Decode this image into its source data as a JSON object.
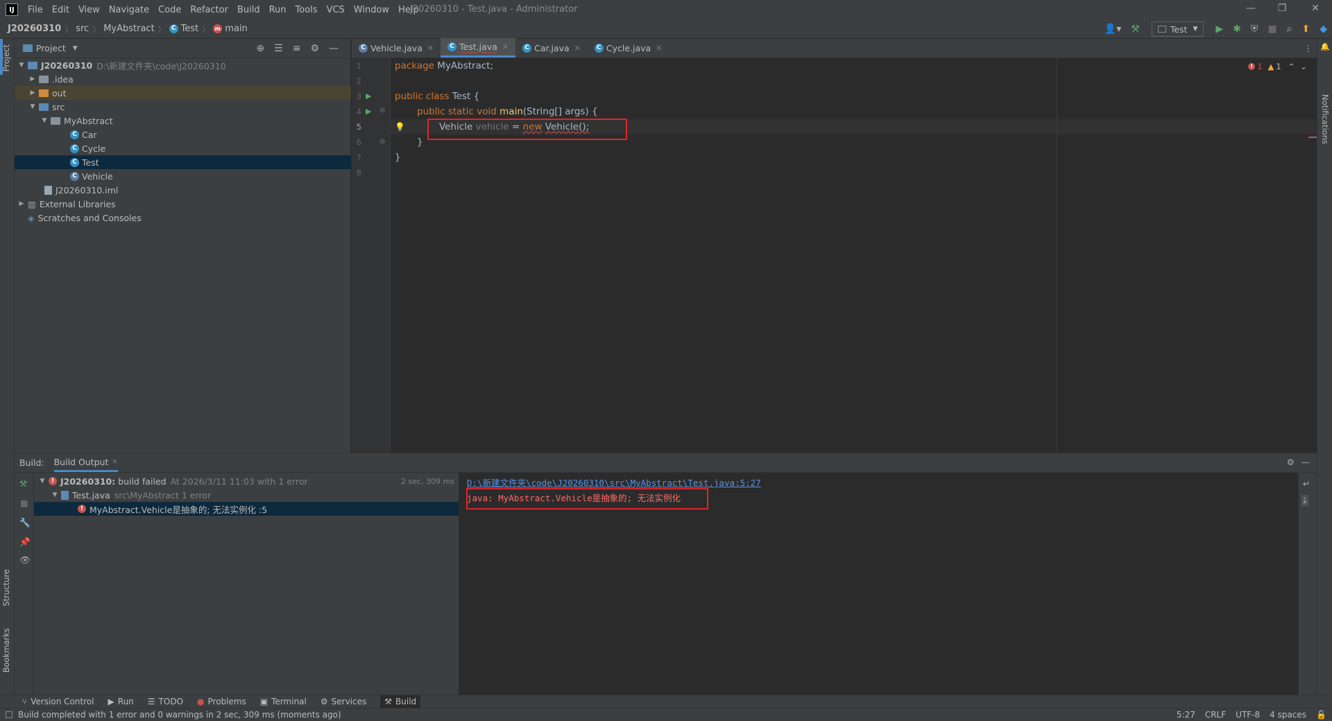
{
  "window": {
    "app_logo": "IJ",
    "title": "J20260310 - Test.java - Administrator"
  },
  "menu": [
    "File",
    "Edit",
    "View",
    "Navigate",
    "Code",
    "Refactor",
    "Build",
    "Run",
    "Tools",
    "VCS",
    "Window",
    "Help"
  ],
  "breadcrumbs": {
    "project": "J20260310",
    "src": "src",
    "package": "MyAbstract",
    "class": "Test",
    "method": "main"
  },
  "toolbar": {
    "run_config": "Test"
  },
  "left_strip": {
    "project_tab": "Project",
    "structure_tab": "Structure",
    "bookmarks_tab": "Bookmarks"
  },
  "right_strip": {
    "notifications_tab": "Notifications"
  },
  "project_panel": {
    "title": "Project",
    "tree": {
      "root": "J20260310",
      "root_path": "D:\\新建文件夹\\code\\J20260310",
      "idea": ".idea",
      "out": "out",
      "src": "src",
      "package": "MyAbstract",
      "car": "Car",
      "cycle": "Cycle",
      "test": "Test",
      "vehicle": "Vehicle",
      "iml": "J20260310.iml",
      "external": "External Libraries",
      "scratches": "Scratches and Consoles"
    }
  },
  "editor": {
    "tabs": [
      "Vehicle.java",
      "Test.java",
      "Car.java",
      "Cycle.java"
    ],
    "active_tab": "Test.java",
    "error_count": "1",
    "warning_count": "1",
    "line_numbers": [
      "1",
      "2",
      "3",
      "4",
      "5",
      "6",
      "7",
      "8"
    ],
    "code": {
      "l1_kw": "package",
      "l1_rest": " MyAbstract;",
      "l3_kw": "public class",
      "l3_rest": " Test {",
      "l4_kw": "public static void",
      "l4_fn": "main",
      "l4_rest": "(String[] args) {",
      "l5_type": "Vehicle",
      "l5_var": "vehicle",
      "l5_eq": " = ",
      "l5_new": "new",
      "l5_ctor": "Vehicle",
      "l5_end": "();",
      "l6": "}",
      "l7": "}"
    }
  },
  "build": {
    "label": "Build:",
    "tab": "Build Output",
    "summary_project": "J20260310:",
    "summary_text": "build failed",
    "summary_time": "At 2026/3/11 11:03 with 1 error",
    "summary_duration": "2 sec, 309 ms",
    "file": "Test.java",
    "file_path": "src\\MyAbstract 1 error",
    "error_item": "MyAbstract.Vehicle是抽象的; 无法实例化 :5",
    "output_link": "D:\\新建文件夹\\code\\J20260310\\src\\MyAbstract\\Test.java:5:27",
    "output_error": "java: MyAbstract.Vehicle是抽象的; 无法实例化"
  },
  "bottom_tools": [
    "Version Control",
    "Run",
    "TODO",
    "Problems",
    "Terminal",
    "Services",
    "Build"
  ],
  "status": {
    "message": "Build completed with 1 error and 0 warnings in 2 sec, 309 ms (moments ago)",
    "position": "5:27",
    "line_sep": "CRLF",
    "encoding": "UTF-8",
    "indent": "4 spaces"
  },
  "colors": {
    "accent": "#4a88c7",
    "error": "#c75450",
    "highlight_box": "#e0252b"
  }
}
